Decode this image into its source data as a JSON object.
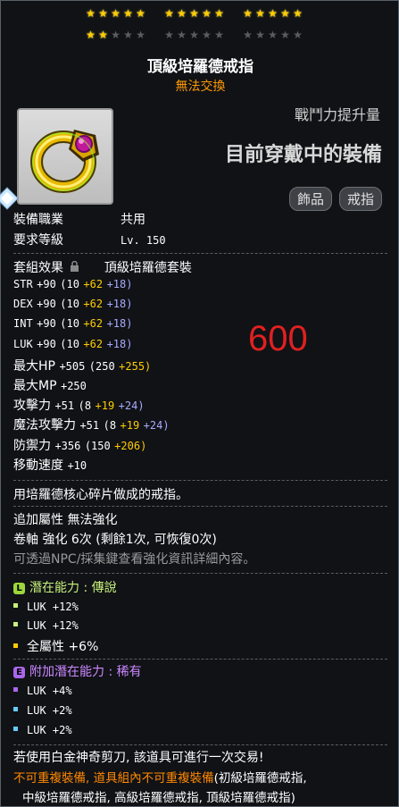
{
  "stars": {
    "row1": [
      [
        1,
        1,
        1,
        1,
        1
      ],
      [
        1,
        1,
        1,
        1,
        1
      ],
      [
        1,
        1,
        1,
        1,
        1
      ]
    ],
    "row2": [
      [
        1,
        1,
        0,
        0,
        0
      ],
      [
        0,
        0,
        0,
        0,
        0
      ],
      [
        0,
        0,
        0,
        0,
        0
      ]
    ],
    "on_glyph": "★",
    "off_glyph": "★"
  },
  "item": {
    "name": "頂級培羅德戒指",
    "trade": "無法交換",
    "icon": "gold-ring-purple-gem-icon",
    "power_label": "戰鬥力提升量",
    "equipped_label": "目前穿戴中的裝備",
    "tags": [
      "飾品",
      "戒指"
    ]
  },
  "req": {
    "job_label": "裝備職業",
    "job_value": "共用",
    "level_label": "要求等級",
    "level_value": "Lv. 150"
  },
  "set": {
    "label": "套組效果",
    "lock_icon": "lock-icon",
    "name": "頂級培羅德套裝"
  },
  "stats": [
    {
      "name": "STR",
      "total": "+90",
      "base": "(10",
      "bonus": "+62",
      "star": "+18)"
    },
    {
      "name": "DEX",
      "total": "+90",
      "base": "(10",
      "bonus": "+62",
      "star": "+18)"
    },
    {
      "name": "INT",
      "total": "+90",
      "base": "(10",
      "bonus": "+62",
      "star": "+18)"
    },
    {
      "name": "LUK",
      "total": "+90",
      "base": "(10",
      "bonus": "+62",
      "star": "+18)"
    },
    {
      "name": "最大HP",
      "total": "+505",
      "base": "(250",
      "bonus": "+255)",
      "star": ""
    },
    {
      "name": "最大MP",
      "total": "+250",
      "base": "",
      "bonus": "",
      "star": ""
    },
    {
      "name": "攻擊力",
      "total": "+51",
      "base": "(8",
      "bonus": "+19",
      "star": "+24)"
    },
    {
      "name": "魔法攻擊力",
      "total": "+51",
      "base": "(8",
      "bonus": "+19",
      "star": "+24)"
    },
    {
      "name": "防禦力",
      "total": "+356",
      "base": "(150",
      "bonus": "+206)",
      "star": ""
    },
    {
      "name": "移動速度",
      "total": "+10",
      "base": "",
      "bonus": "",
      "star": ""
    }
  ],
  "overlay_number": "600",
  "description": "用培羅德核心碎片做成的戒指。",
  "extra": {
    "attr": "追加屬性  無法強化",
    "scroll": "卷軸 強化 6次 (剩餘1次, 可恢復0次)",
    "hint": "可透過NPC/採集鍵查看強化資訊詳細內容。"
  },
  "potential": {
    "badge": "L",
    "title": "潛在能力 : 傳說",
    "color": "#c8f07a",
    "lines": [
      "LUK +12%",
      "LUK +12%",
      "全屬性 +6%"
    ]
  },
  "bonus_potential": {
    "badge": "E",
    "title": "附加潛在能力 : 稀有",
    "color": "#cc88ff",
    "lines": [
      "LUK +4%",
      "LUK +2%",
      "LUK +2%"
    ]
  },
  "footer": {
    "line1": "若使用白金神奇剪刀, 該道具可進行一次交易!",
    "line2_orange": "不可重複裝備, 道具組內不可重複裝備",
    "line2_rest": "(初級培羅德戒指,",
    "line3": "中級培羅德戒指, 高級培羅德戒指, 頂級培羅德戒指)"
  }
}
